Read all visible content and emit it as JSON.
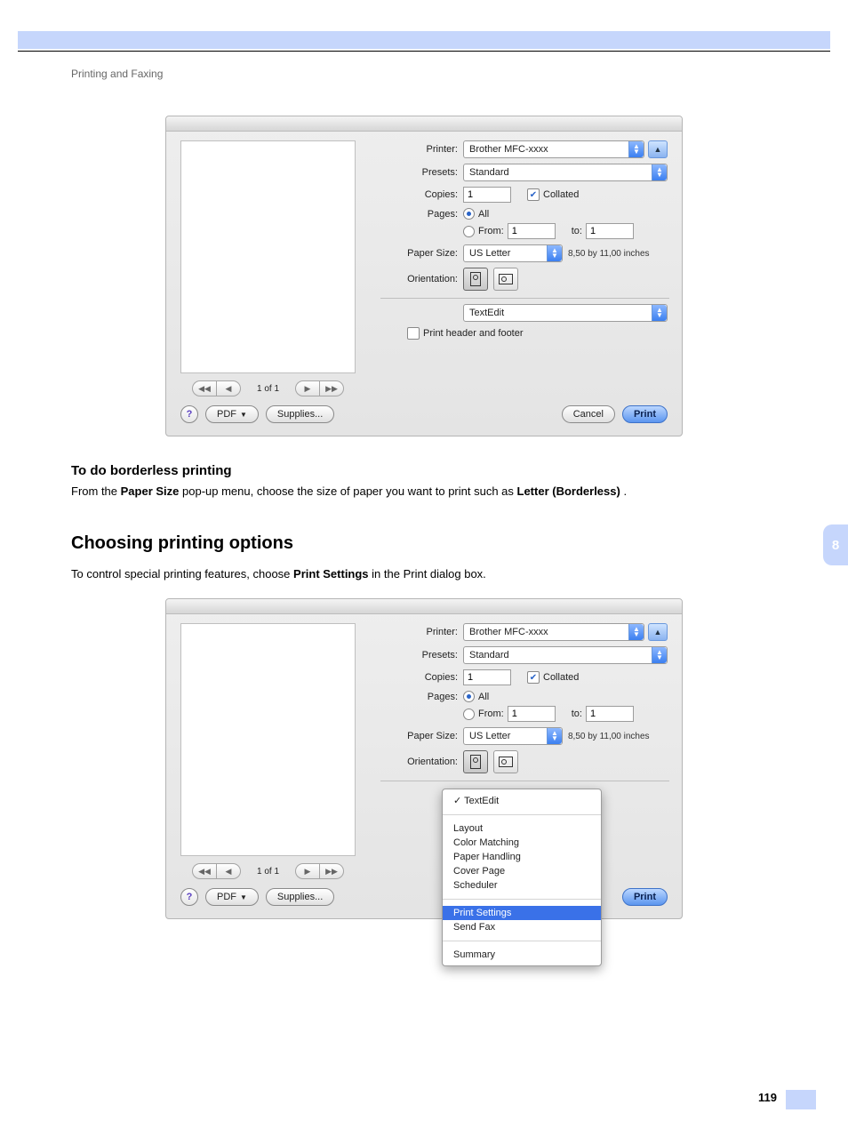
{
  "header": {
    "title": "Printing and Faxing"
  },
  "chapter": {
    "number": "8"
  },
  "page": {
    "number": "119"
  },
  "section1": {
    "heading": "To do borderless printing",
    "body_pre": "From the ",
    "body_b1": "Paper Size",
    "body_mid": " pop-up menu, choose the size of paper you want to print such as ",
    "body_b2": "Letter (Borderless)",
    "body_post": " ."
  },
  "section2": {
    "heading": "Choosing printing options",
    "body_pre": "To control special printing features, choose ",
    "body_b1": "Print Settings",
    "body_post": " in the Print dialog box."
  },
  "dialog": {
    "labels": {
      "printer": "Printer:",
      "presets": "Presets:",
      "copies": "Copies:",
      "collated": "Collated",
      "pages": "Pages:",
      "all": "All",
      "from": "From:",
      "to": "to:",
      "paper_size": "Paper Size:",
      "orientation": "Orientation:",
      "print_hf": "Print header and footer"
    },
    "values": {
      "printer": "Brother MFC-xxxx",
      "presets": "Standard",
      "copies": "1",
      "from": "1",
      "to": "1",
      "paper_size": "US Letter",
      "paper_dim": "8,50 by 11,00 inches",
      "section": "TextEdit"
    },
    "pager": "1 of 1",
    "buttons": {
      "pdf": "PDF",
      "supplies": "Supplies...",
      "cancel": "Cancel",
      "print": "Print"
    }
  },
  "popup": {
    "checked": "TextEdit",
    "group1": [
      "Layout",
      "Color Matching",
      "Paper Handling",
      "Cover Page",
      "Scheduler"
    ],
    "highlighted": "Print Settings",
    "after": "Send Fax",
    "group3": "Summary",
    "ghost": "Print header and footer"
  }
}
